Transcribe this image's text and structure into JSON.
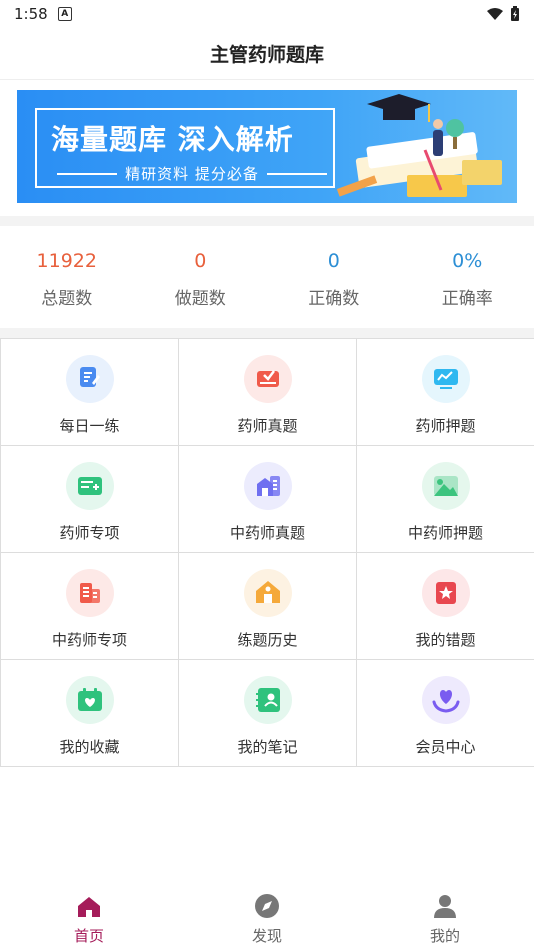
{
  "status": {
    "time": "1:58",
    "notif": "A"
  },
  "header": {
    "title": "主管药师题库"
  },
  "banner": {
    "headline": "海量题库 深入解析",
    "subline": "精研资料 提分必备"
  },
  "stats": [
    {
      "value": "11922",
      "label": "总题数",
      "color": "#e8603c"
    },
    {
      "value": "0",
      "label": "做题数",
      "color": "#e8603c"
    },
    {
      "value": "0",
      "label": "正确数",
      "color": "#2d8fd5"
    },
    {
      "value": "0%",
      "label": "正确率",
      "color": "#2d8fd5"
    }
  ],
  "grid": [
    {
      "label": "每日一练",
      "icon": "pencil-note-icon",
      "color": "#4a8bf0",
      "bg": "#e8f1fd"
    },
    {
      "label": "药师真题",
      "icon": "envelope-icon",
      "color": "#f05a4a",
      "bg": "#fde9e7"
    },
    {
      "label": "药师押题",
      "icon": "monitor-icon",
      "color": "#2fb8f0",
      "bg": "#e5f6fd"
    },
    {
      "label": "药师专项",
      "icon": "card-icon",
      "color": "#2fc27d",
      "bg": "#e4f7ee"
    },
    {
      "label": "中药师真题",
      "icon": "building-icon",
      "color": "#6f6ff0",
      "bg": "#ececfd"
    },
    {
      "label": "中药师押题",
      "icon": "landscape-icon",
      "color": "#3cc47e",
      "bg": "#e5f7ed"
    },
    {
      "label": "中药师专项",
      "icon": "office-icon",
      "color": "#f05a4a",
      "bg": "#fde9e7"
    },
    {
      "label": "练题历史",
      "icon": "house-icon",
      "color": "#f5a93a",
      "bg": "#fdf2e2"
    },
    {
      "label": "我的错题",
      "icon": "star-box-icon",
      "color": "#e8474f",
      "bg": "#fde7e8"
    },
    {
      "label": "我的收藏",
      "icon": "calendar-heart-icon",
      "color": "#2fc27d",
      "bg": "#e4f7ee"
    },
    {
      "label": "我的笔记",
      "icon": "contact-book-icon",
      "color": "#2fc27d",
      "bg": "#e4f7ee"
    },
    {
      "label": "会员中心",
      "icon": "heart-hands-icon",
      "color": "#7a5cf0",
      "bg": "#eeeafd"
    }
  ],
  "tabs": [
    {
      "label": "首页",
      "icon": "home-icon",
      "active": true
    },
    {
      "label": "发现",
      "icon": "compass-icon",
      "active": false
    },
    {
      "label": "我的",
      "icon": "person-icon",
      "active": false
    }
  ],
  "colors": {
    "accent": "#a51c5a",
    "banner": "#2a8ef4"
  }
}
